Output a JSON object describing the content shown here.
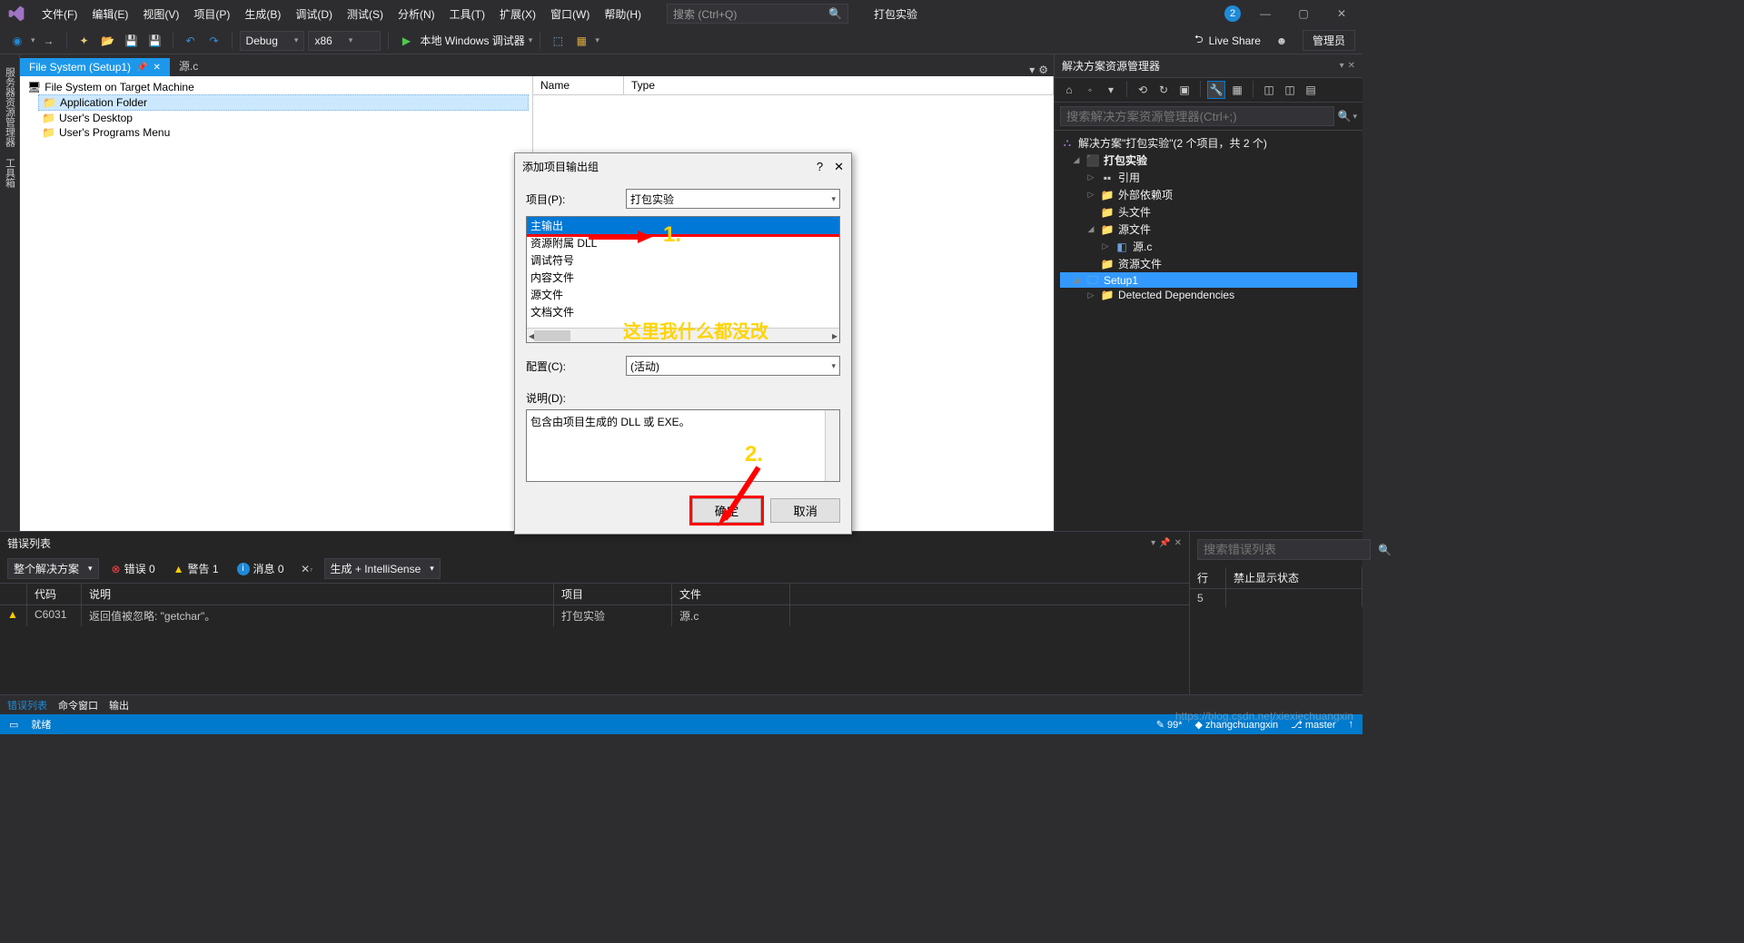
{
  "menubar": {
    "items": [
      "文件(F)",
      "编辑(E)",
      "视图(V)",
      "项目(P)",
      "生成(B)",
      "调试(D)",
      "测试(S)",
      "分析(N)",
      "工具(T)",
      "扩展(X)",
      "窗口(W)",
      "帮助(H)"
    ],
    "search_placeholder": "搜索 (Ctrl+Q)",
    "experiment_btn": "打包实验",
    "notif": "2"
  },
  "toolbar": {
    "config": "Debug",
    "platform": "x86",
    "debug_target": "本地 Windows 调试器",
    "live_share": "Live Share",
    "admin": "管理员"
  },
  "tabs": {
    "active": "File System (Setup1)",
    "inactive": "源.c"
  },
  "filesystem": {
    "root": "File System on Target Machine",
    "nodes": [
      "Application Folder",
      "User's Desktop",
      "User's Programs Menu"
    ],
    "cols": [
      "Name",
      "Type"
    ]
  },
  "solution": {
    "title": "解决方案资源管理器",
    "search_placeholder": "搜索解决方案资源管理器(Ctrl+;)",
    "root": "解决方案\"打包实验\"(2 个项目，共 2 个)",
    "proj1": "打包实验",
    "refs": "引用",
    "ext_deps": "外部依赖项",
    "headers": "头文件",
    "sources": "源文件",
    "src1": "源.c",
    "res": "资源文件",
    "proj2": "Setup1",
    "detected": "Detected Dependencies"
  },
  "errorlist": {
    "title": "错误列表",
    "scope": "整个解决方案",
    "errors": "错误 0",
    "warnings": "警告 1",
    "messages": "消息 0",
    "build_filter": "生成 + IntelliSense",
    "search_placeholder": "搜索错误列表",
    "cols": [
      "",
      "代码",
      "说明",
      "项目",
      "文件",
      "行",
      "禁止显示状态"
    ],
    "row": {
      "code": "C6031",
      "desc": "返回值被忽略: \"getchar\"。",
      "proj": "打包实验",
      "file": "源.c",
      "line": "5"
    }
  },
  "bottom_tabs": [
    "错误列表",
    "命令窗口",
    "输出"
  ],
  "status": {
    "ready": "就绪",
    "count": "99*",
    "user": "zhangchuangxin",
    "branch": "master"
  },
  "dialog": {
    "title": "添加项目输出组",
    "project_label": "项目(P):",
    "project_value": "打包实验",
    "items": [
      "主输出",
      "资源附属 DLL",
      "调试符号",
      "内容文件",
      "源文件",
      "文档文件"
    ],
    "config_label": "配置(C):",
    "config_value": "(活动)",
    "desc_label": "说明(D):",
    "desc_value": "包含由项目生成的 DLL 或 EXE。",
    "ok": "确定",
    "cancel": "取消"
  },
  "annotations": {
    "a1": "1.",
    "a2": "2.",
    "text1": "这里我什么都没改"
  },
  "watermark": "https://blog.csdn.net/xiexiechuangxin"
}
